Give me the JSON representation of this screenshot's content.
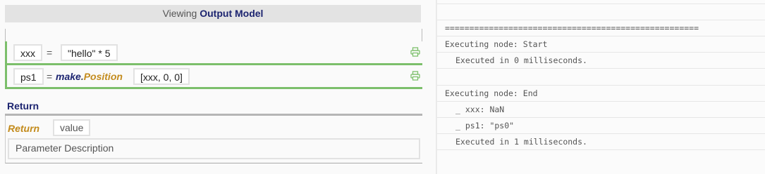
{
  "header": {
    "prefix": "Viewing",
    "model": "Output Model"
  },
  "statements": [
    {
      "var": "xxx",
      "eq": "=",
      "expr": "\"hello\" * 5"
    },
    {
      "var": "ps1",
      "eq": "=",
      "fn_module": "make",
      "fn_dot": ".",
      "fn_name": "Position",
      "arg": "[xxx, 0, 0]"
    }
  ],
  "return_section": {
    "title": "Return",
    "keyword": "Return",
    "value": "value",
    "param_description": "Parameter Description"
  },
  "console": [
    "",
    "====================================================",
    "Executing node: Start",
    "  Executed in 0 milliseconds.",
    "",
    "Executing node: End",
    "  _ xxx: NaN",
    "  _ ps1: \"ps0\"",
    "  Executed in 1 milliseconds.",
    ""
  ],
  "colors": {
    "accent_green": "#7cbf6b",
    "navy": "#1c2470",
    "gold": "#c38b1c"
  },
  "icons": {
    "statement_action": "printer-icon"
  }
}
